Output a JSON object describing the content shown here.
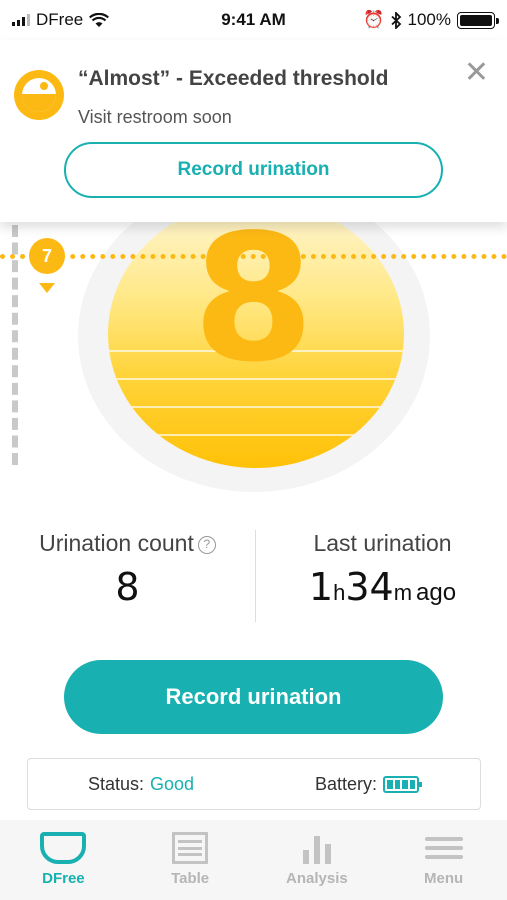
{
  "status_bar": {
    "carrier": "DFree",
    "time": "9:41 AM",
    "battery_pct": "100%"
  },
  "notification": {
    "title": "“Almost” - Exceeded threshold",
    "subtitle": "Visit restroom soon",
    "button_label": "Record urination",
    "close_glyph": "✕"
  },
  "gauge": {
    "count": "8",
    "threshold": "7"
  },
  "stats": {
    "count_label": "Urination count",
    "help_glyph": "?",
    "count_value": "8",
    "last_label": "Last urination",
    "last_hours": "1",
    "last_hours_unit": "h",
    "last_minutes": "34",
    "last_minutes_unit": "m",
    "last_suffix": "ago"
  },
  "main_button": {
    "label": "Record urination"
  },
  "device_status": {
    "status_label": "Status:",
    "status_value": "Good",
    "battery_label": "Battery:",
    "battery_level": 1.0
  },
  "tabs": [
    {
      "label": "DFree",
      "icon": "dfree-icon",
      "active": true
    },
    {
      "label": "Table",
      "icon": "table-icon",
      "active": false
    },
    {
      "label": "Analysis",
      "icon": "analysis-icon",
      "active": false
    },
    {
      "label": "Menu",
      "icon": "menu-icon",
      "active": false
    }
  ],
  "colors": {
    "accent": "#18b0b0",
    "gauge": "#fdb913"
  }
}
